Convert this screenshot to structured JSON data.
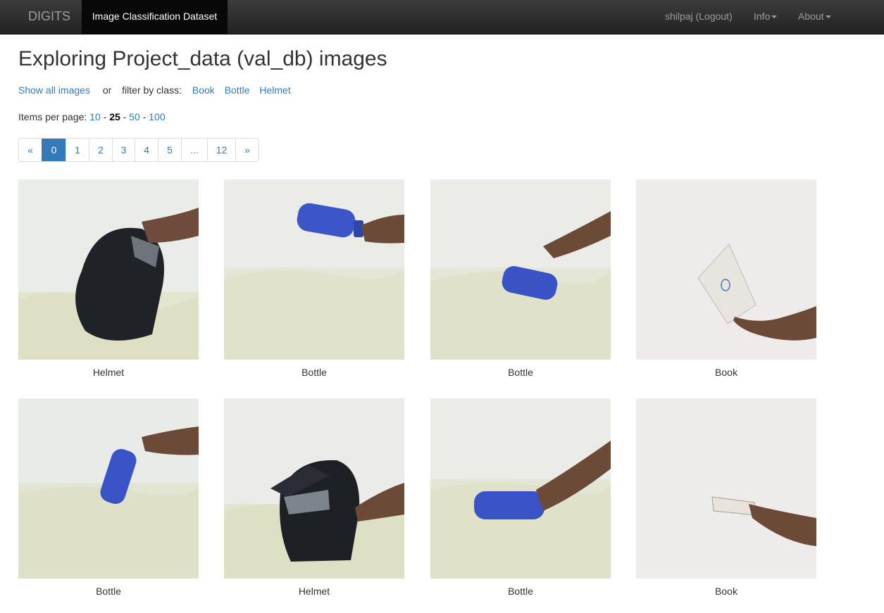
{
  "navbar": {
    "brand": "DIGITS",
    "active_tab": "Image Classification Dataset",
    "user": "shilpaj (Logout)",
    "info": "Info",
    "about": "About"
  },
  "heading": "Exploring Project_data (val_db) images",
  "filter": {
    "show_all": "Show all images",
    "or": "or",
    "filter_label": "filter by class:",
    "classes": [
      "Book",
      "Bottle",
      "Helmet"
    ]
  },
  "items_per_page": {
    "label": "Items per page:",
    "options": [
      "10",
      "25",
      "50",
      "100"
    ],
    "selected": "25",
    "sep": "-"
  },
  "pagination": [
    "«",
    "0",
    "1",
    "2",
    "3",
    "4",
    "5",
    "...",
    "12",
    "»"
  ],
  "current_page": "0",
  "images": [
    {
      "label": "Helmet"
    },
    {
      "label": "Bottle"
    },
    {
      "label": "Bottle"
    },
    {
      "label": "Book"
    },
    {
      "label": "Bottle"
    },
    {
      "label": "Helmet"
    },
    {
      "label": "Bottle"
    },
    {
      "label": "Book"
    }
  ]
}
